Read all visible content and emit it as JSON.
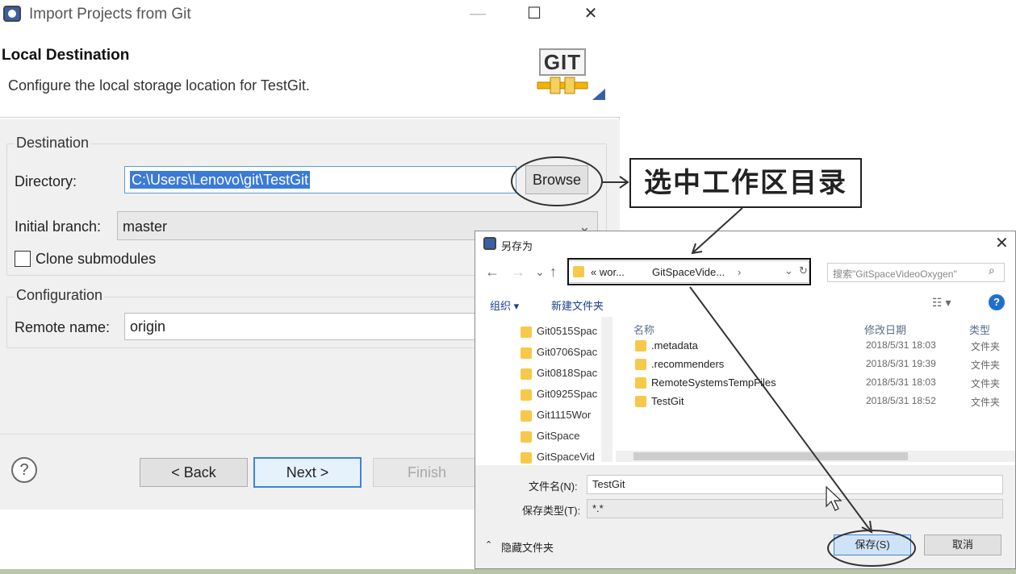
{
  "wizard": {
    "title": "Import Projects from Git",
    "controls": {
      "minimize": "—",
      "maximize": "☐",
      "close": "✕"
    },
    "header": {
      "title": "Local Destination",
      "description": "Configure the local storage location for TestGit.",
      "logo_text": "GIT"
    },
    "destination": {
      "group_label": "Destination",
      "directory_label": "Directory:",
      "directory_value": "C:\\Users\\Lenovo\\git\\TestGit",
      "browse_label": "Browse",
      "branch_label": "Initial branch:",
      "branch_value": "master",
      "clone_submodules_label": "Clone submodules"
    },
    "configuration": {
      "group_label": "Configuration",
      "remote_name_label": "Remote name:",
      "remote_name_value": "origin"
    },
    "footer": {
      "help": "?",
      "back_label": "< Back",
      "next_label": "Next >",
      "finish_label": "Finish"
    }
  },
  "annotation": {
    "text": "选中工作区目录"
  },
  "save_dialog": {
    "title": "另存为",
    "close": "✕",
    "nav": {
      "back": "←",
      "forward": "→",
      "recent": "⌄",
      "up": "↑"
    },
    "address": [
      "« wor...",
      "GitSpaceVide...",
      "›"
    ],
    "search_placeholder": "搜索\"GitSpaceVideoOxygen\"",
    "toolbar": {
      "organize": "组织 ▾",
      "new_folder": "新建文件夹"
    },
    "tree": [
      "Git0515Spac",
      "Git0706Spac",
      "Git0818Spac",
      "Git0925Spac",
      "Git1115Wor",
      "GitSpace",
      "GitSpaceVid"
    ],
    "columns": {
      "name": "名称",
      "modified": "修改日期",
      "type": "类型"
    },
    "rows": [
      {
        "name": ".metadata",
        "date": "2018/5/31 18:03",
        "type": "文件夹"
      },
      {
        "name": ".recommenders",
        "date": "2018/5/31 19:39",
        "type": "文件夹"
      },
      {
        "name": "RemoteSystemsTempFiles",
        "date": "2018/5/31 18:03",
        "type": "文件夹"
      },
      {
        "name": "TestGit",
        "date": "2018/5/31 18:52",
        "type": "文件夹"
      }
    ],
    "filename_label": "文件名(N):",
    "filename_value": "TestGit",
    "filetype_label": "保存类型(T):",
    "filetype_value": "*.*",
    "hide_folders_label": "隐藏文件夹",
    "save_label": "保存(S)",
    "cancel_label": "取消"
  },
  "colors": {
    "selection": "#3b7ad8",
    "accent": "#3d85d8",
    "folder": "#f7c94a"
  }
}
